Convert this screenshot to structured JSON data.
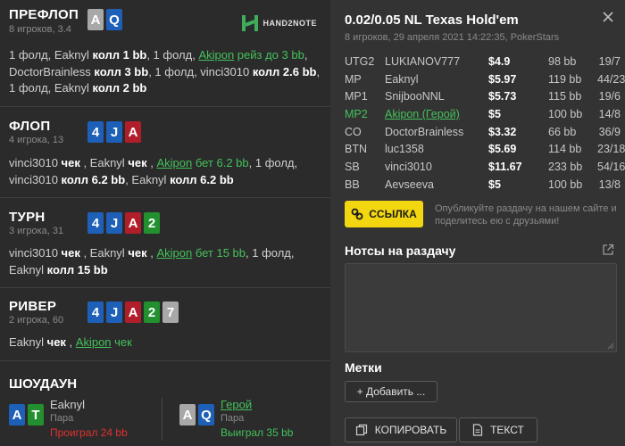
{
  "preflop": {
    "title": "ПРЕФЛОП",
    "sub": "8 игроков, 3.4",
    "cards": [
      "A",
      "Q"
    ],
    "line1": [
      "1 фолд, Eaknyl ",
      "колл 1 bb",
      ", 1 фолд, ",
      "Akipon",
      " рейз до 3 bb",
      ","
    ],
    "line2": [
      "DoctorBrainless ",
      "колл 3 bb",
      ", 1 фолд, vinci3010 ",
      "колл 2.6 bb",
      ","
    ],
    "line3": [
      "1 фолд, Eaknyl ",
      "колл 2 bb"
    ]
  },
  "logo": {
    "text": "HAND2NOTE"
  },
  "flop": {
    "title": "ФЛОП",
    "sub": "4 игрока, 13",
    "cards": [
      "4",
      "J",
      "A"
    ],
    "line1": [
      "vinci3010 ",
      "чек",
      " , Eaknyl ",
      "чек",
      " , ",
      "Akipon",
      " бет 6.2 bb",
      ", 1 фолд,"
    ],
    "line2": [
      "vinci3010 ",
      "колл 6.2 bb",
      ", Eaknyl ",
      "колл 6.2 bb"
    ]
  },
  "turn": {
    "title": "ТУРН",
    "sub": "3 игрока, 31",
    "cards": [
      "4",
      "J",
      "A",
      "2"
    ],
    "line1": [
      "vinci3010 ",
      "чек",
      " , Eaknyl ",
      "чек",
      " , ",
      "Akipon",
      " бет 15 bb",
      ", 1 фолд,"
    ],
    "line2": [
      "Eaknyl ",
      "колл 15 bb"
    ]
  },
  "river": {
    "title": "РИВЕР",
    "sub": "2 игрока, 60",
    "cards": [
      "4",
      "J",
      "A",
      "2",
      "7"
    ],
    "line1": [
      "Eaknyl ",
      "чек",
      " , ",
      "Akipon",
      " чек"
    ]
  },
  "showdown": {
    "title": "ШОУДАУН",
    "p1": {
      "cards": [
        "A",
        "T"
      ],
      "name": "Eaknyl",
      "hand": "Пара",
      "result": "Проиграл 24 bb"
    },
    "p2": {
      "cards": [
        "A",
        "Q"
      ],
      "name": "Герой",
      "hand": "Пара",
      "result": "Выиграл 35 bb"
    }
  },
  "game": {
    "title": "0.02/0.05 NL Texas Hold'em",
    "sub": "8 игроков, 29 апреля 2021 14:22:35, PokerStars"
  },
  "players": [
    {
      "pos": "UTG2",
      "name": "LUKIANOV777",
      "stack": "$4.9",
      "bb": "98 bb",
      "stat": "19/7"
    },
    {
      "pos": "MP",
      "name": "Eaknyl",
      "stack": "$5.97",
      "bb": "119 bb",
      "stat": "44/23"
    },
    {
      "pos": "MP1",
      "name": "SnijbooNNL",
      "stack": "$5.73",
      "bb": "115 bb",
      "stat": "19/6"
    },
    {
      "pos": "MP2",
      "name": "Akipon (Герой)",
      "stack": "$5",
      "bb": "100 bb",
      "stat": "14/8"
    },
    {
      "pos": "CO",
      "name": "DoctorBrainless",
      "stack": "$3.32",
      "bb": "66 bb",
      "stat": "36/9"
    },
    {
      "pos": "BTN",
      "name": "luc1358",
      "stack": "$5.69",
      "bb": "114 bb",
      "stat": "23/18"
    },
    {
      "pos": "SB",
      "name": "vinci3010",
      "stack": "$11.67",
      "bb": "233 bb",
      "stat": "54/16"
    },
    {
      "pos": "BB",
      "name": "Aevseeva",
      "stack": "$5",
      "bb": "100 bb",
      "stat": "13/8"
    }
  ],
  "link_button": "ССЫЛКА",
  "share_text": "Опубликуйте раздачу на нашем сайте и поделитесь ею с друзьями!",
  "notes_title": "Нотсы на раздачу",
  "tags_title": "Метки",
  "add_button": "+ Добавить ...",
  "copy_button": "КОПИРОВАТЬ",
  "text_button": "ТЕКСТ",
  "colors": {
    "hero": "#43c15b",
    "link_yellow": "#f2d60f",
    "spade": "#a8a8a8",
    "club": "#23902f",
    "diamond": "#1e5fb8",
    "heart": "#b21d2a",
    "loss": "#e0312f"
  }
}
